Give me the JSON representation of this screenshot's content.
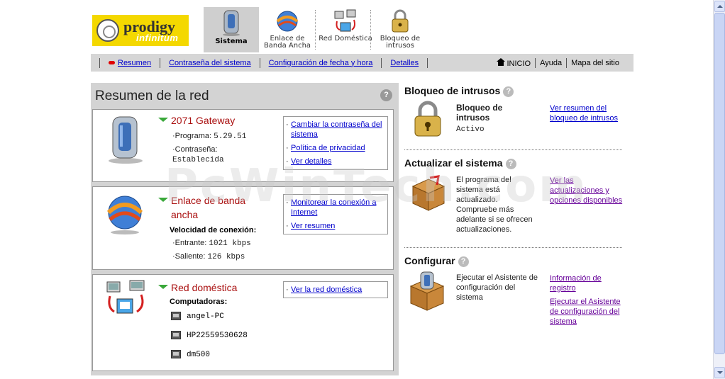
{
  "header": {
    "brand": "prodigy",
    "brand_sub": "infinitum",
    "tabs": [
      {
        "label": "Sistema",
        "icon": "gateway-icon",
        "active": true
      },
      {
        "label": "Enlace de Banda Ancha",
        "icon": "broadband-globe-icon"
      },
      {
        "label": "Red Doméstica",
        "icon": "home-network-icon"
      },
      {
        "label": "Bloqueo de intrusos",
        "icon": "padlock-icon"
      }
    ]
  },
  "menubar": {
    "links": [
      "Resumen",
      "Contraseña del sistema",
      "Configuración de fecha y hora",
      "Detalles"
    ],
    "right": [
      "INICIO",
      "Ayuda",
      "Mapa del sitio"
    ]
  },
  "summary": {
    "title": "Resumen de la red",
    "help": "?",
    "gateway": {
      "title": "2071 Gateway",
      "program_label": "Programa:",
      "program_value": "5.29.51",
      "password_label": "Contraseña:",
      "password_value": "Establecida",
      "links": [
        "Cambiar la contraseña del sistema",
        "Política de privacidad",
        "Ver detalles"
      ]
    },
    "broadband": {
      "title": "Enlace de banda ancha",
      "speed_label": "Velocidad de conexión:",
      "in_label": "Entrante:",
      "in_value": "1021 kbps",
      "out_label": "Saliente:",
      "out_value": "126 kbps",
      "links": [
        "Monitorear la conexión a Internet",
        "Ver resumen"
      ]
    },
    "home": {
      "title": "Red doméstica",
      "computers_label": "Computadoras:",
      "computers": [
        "angel-PC",
        "HP22559530628",
        "dm500"
      ],
      "links": [
        "Ver la red doméstica"
      ]
    }
  },
  "right": {
    "intrusion": {
      "title": "Bloqueo de intrusos",
      "help": "?",
      "name": "Bloqueo de intrusos",
      "status": "Activo",
      "link": "Ver resumen del bloqueo de intrusos"
    },
    "update": {
      "title": "Actualizar el sistema",
      "help": "?",
      "text": "El programa del sistema está actualizado. Compruebe más adelante si se ofrecen actualizaciones.",
      "link": "Ver las actualizaciones y opciones disponibles"
    },
    "configure": {
      "title": "Configurar",
      "help": "?",
      "text": "Ejecutar el Asistente de configuración del sistema",
      "links": [
        "Información de registro",
        "Ejecutar el Asistente de configuración del sistema"
      ]
    }
  },
  "watermark": "PcWinTech.com"
}
